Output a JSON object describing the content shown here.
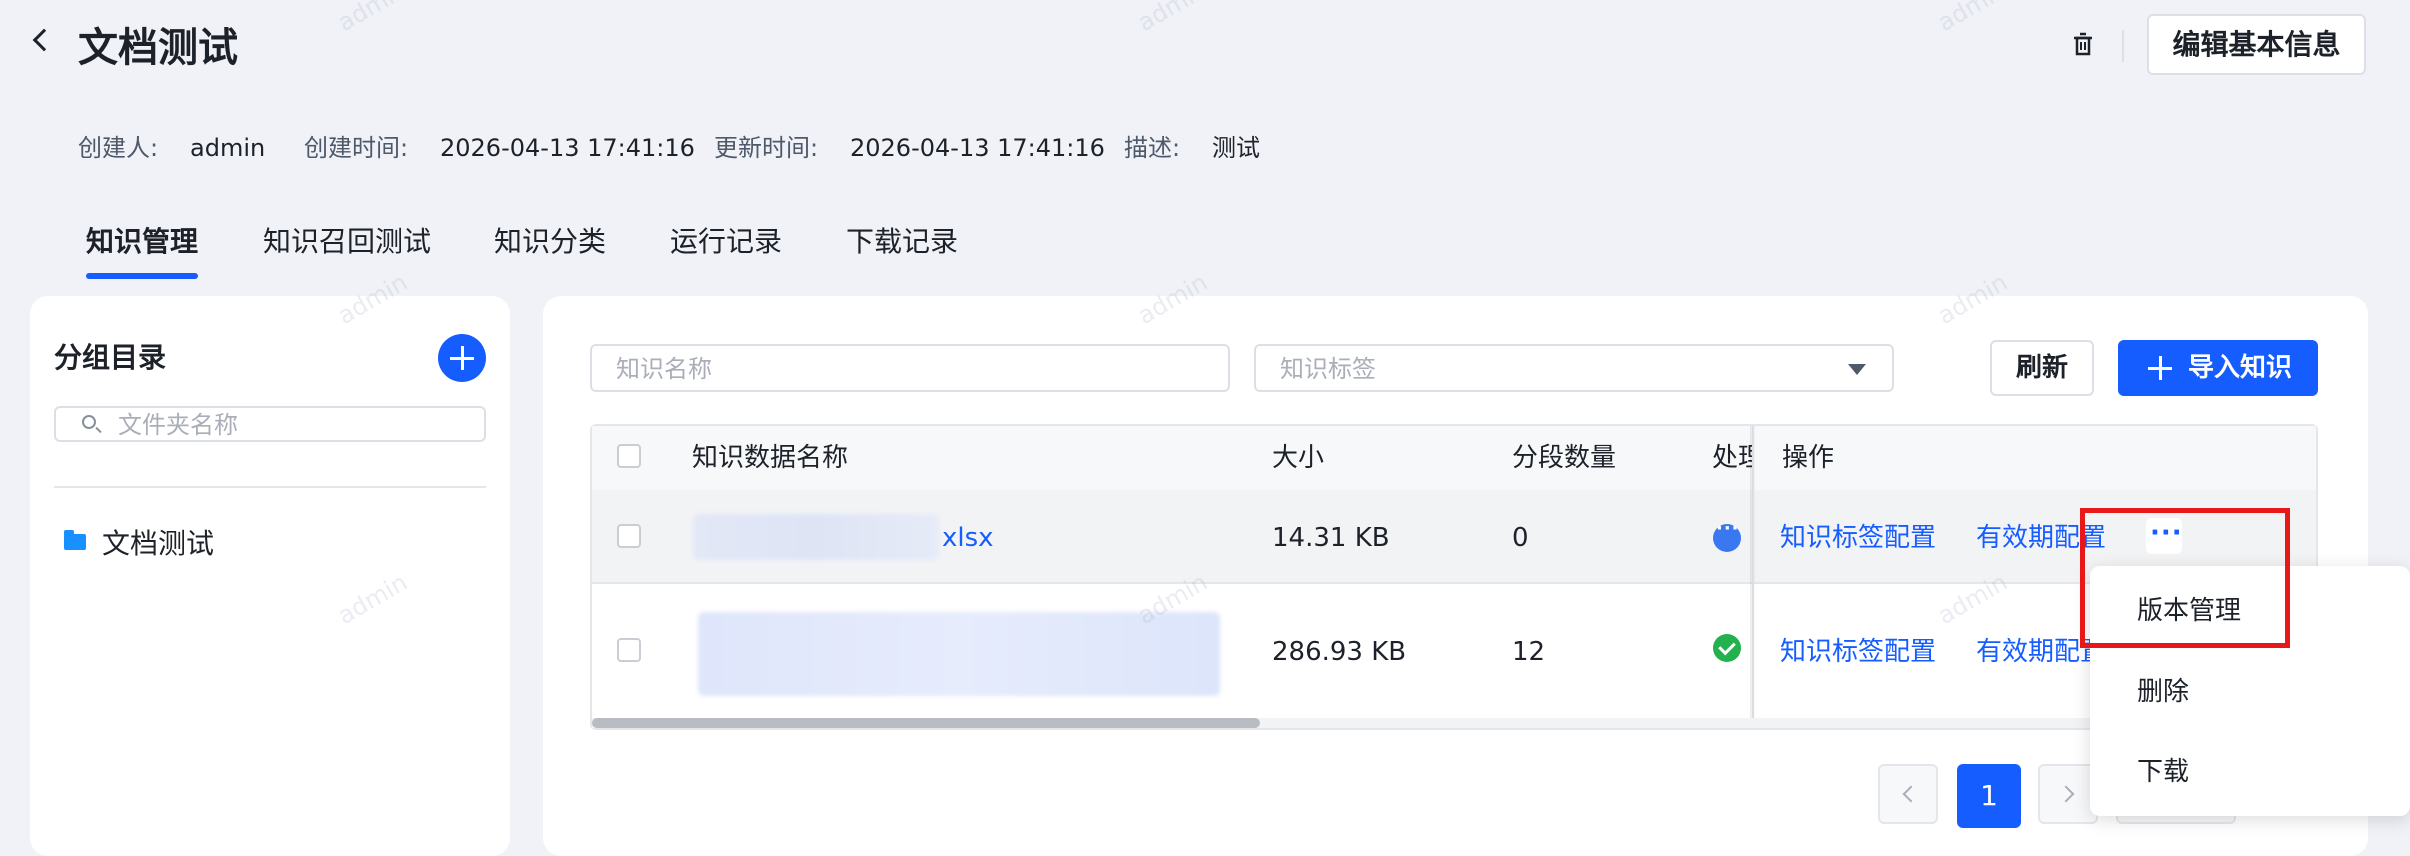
{
  "header": {
    "title": "文档测试",
    "edit_button": "编辑基本信息"
  },
  "meta": {
    "creator_label": "创建人:",
    "creator": "admin",
    "created_label": "创建时间:",
    "created": "2026-04-13 17:41:16",
    "updated_label": "更新时间:",
    "updated": "2026-04-13 17:41:16",
    "desc_label": "描述:",
    "desc": "测试"
  },
  "tabs": [
    {
      "label": "知识管理"
    },
    {
      "label": "知识召回测试"
    },
    {
      "label": "知识分类"
    },
    {
      "label": "运行记录"
    },
    {
      "label": "下载记录"
    }
  ],
  "sidebar": {
    "title": "分组目录",
    "search_placeholder": "文件夹名称",
    "folders": [
      {
        "name": "文档测试"
      }
    ]
  },
  "toolbar": {
    "name_placeholder": "知识名称",
    "tag_placeholder": "知识标签",
    "refresh": "刷新",
    "import": "导入知识"
  },
  "table": {
    "columns": [
      "知识数据名称",
      "大小",
      "分段数量",
      "处理",
      "操作"
    ],
    "rows": [
      {
        "name": "xlsx",
        "size": "14.31 KB",
        "segments": "0",
        "status": "processing",
        "op_tag": "知识标签配置",
        "op_expiry": "有效期配置"
      },
      {
        "name": "",
        "size": "286.93 KB",
        "segments": "12",
        "status": "done",
        "op_tag": "知识标签配置",
        "op_expiry": "有效期配置"
      }
    ],
    "more_icon": "···"
  },
  "pagination": {
    "current": "1"
  },
  "dropdown": {
    "items": [
      {
        "label": "版本管理"
      },
      {
        "label": "删除"
      },
      {
        "label": "下载"
      }
    ]
  },
  "colors": {
    "accent": "#165dff",
    "highlight_box": "#e81818",
    "status_processing": "#3a78f2",
    "status_done": "#23b14d"
  },
  "watermark": "admin"
}
